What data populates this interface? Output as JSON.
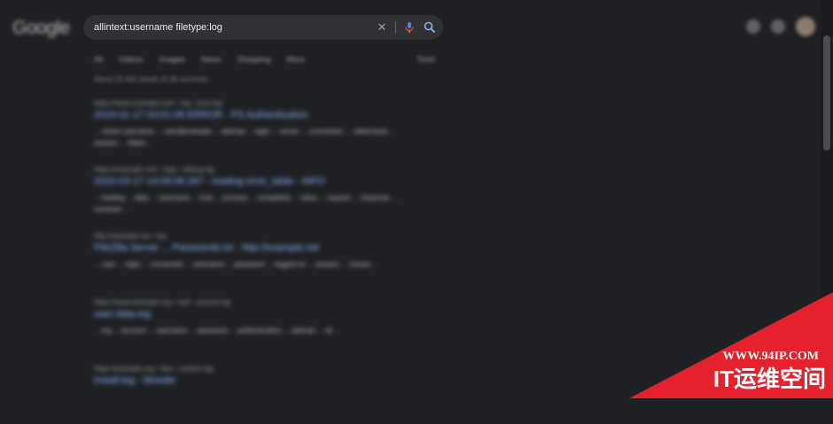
{
  "header": {
    "logo": "Google"
  },
  "search": {
    "query": "allintext:username filetype:log",
    "placeholder": ""
  },
  "icons": {
    "clear": "close-icon",
    "mic": "mic-icon",
    "search": "search-icon",
    "settings": "gear-icon",
    "apps": "apps-icon",
    "avatar": "avatar"
  },
  "tabs": [
    "All",
    "Videos",
    "Images",
    "News",
    "Shopping",
    "More"
  ],
  "tools_label": "Tools",
  "stats": "About 23,400 results (0.38 seconds)",
  "results": [
    {
      "url": "https://www.example.com › log › error.log",
      "title": "2019-01-17 03:01:08 ERROR - PS Authentication",
      "snippet": "... check username ... user@example ... attempt ... login ... server ... connection ... rolled back ... session ... failed ..."
    },
    {
      "url": "https://example.com › logs › debug.log",
      "title": "2020-03-17 14:09:06.267 - loading error_table - INFO",
      "snippet": "... loading ... data ... username ... host ... process ... completed ... value ... request ... response ... received ..."
    },
    {
      "url": "http://example.net › log",
      "title": "FileZilla Server ... Passwords.txt - http://example.net",
      "snippet": "... user ... login ... connected ... username ... password ... logged on ... session ... closed ..."
    },
    {
      "url": "https://www.example.org › web › access.log",
      "title": "user-data.log",
      "snippet": "... log ... account ... username ... password ... authentication ... attempt ... ok ..."
    },
    {
      "url": "https://example.org › files › system.log",
      "title": "install.log - Moodle",
      "snippet": ""
    }
  ],
  "watermark": {
    "url": "WWW.94IP.COM",
    "name": "IT运维空间"
  },
  "colors": {
    "background": "#202124",
    "searchbar": "#303134",
    "link": "#8ab4f8",
    "watermark": "#e5212e"
  }
}
